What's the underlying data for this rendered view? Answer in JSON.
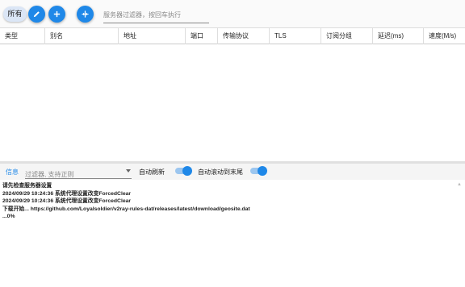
{
  "toolbar": {
    "all_label": "所有",
    "search_placeholder": "服务器过滤器，按回车执行"
  },
  "grid": {
    "columns": [
      "类型",
      "别名",
      "地址",
      "端口",
      "传输协议",
      "TLS",
      "订阅分组",
      "延迟(ms)",
      "速度(M/s)"
    ]
  },
  "logbar": {
    "tab_label": "信息",
    "filter_placeholder": "过滤器, 支持正则",
    "auto_refresh_label": "自动刷新",
    "auto_refresh_on": true,
    "auto_scroll_label": "自动滚动到末尾",
    "auto_scroll_on": true
  },
  "log": {
    "lines": [
      "请先检查服务器设置",
      "2024/09/29 10:24:36 系统代理设置改变ForcedClear",
      "2024/09/29 10:24:36 系统代理设置改变ForcedClear",
      "下载开始...  https://github.com/Loyalsoldier/v2ray-rules-dat/releases/latest/download/geosite.dat",
      "...0%"
    ]
  },
  "colors": {
    "accent": "#1f88e8",
    "chip_bg": "#dbe6f6"
  },
  "icons": [
    "edit-icon",
    "add-icon",
    "split-icon",
    "scroll-up-icon"
  ]
}
